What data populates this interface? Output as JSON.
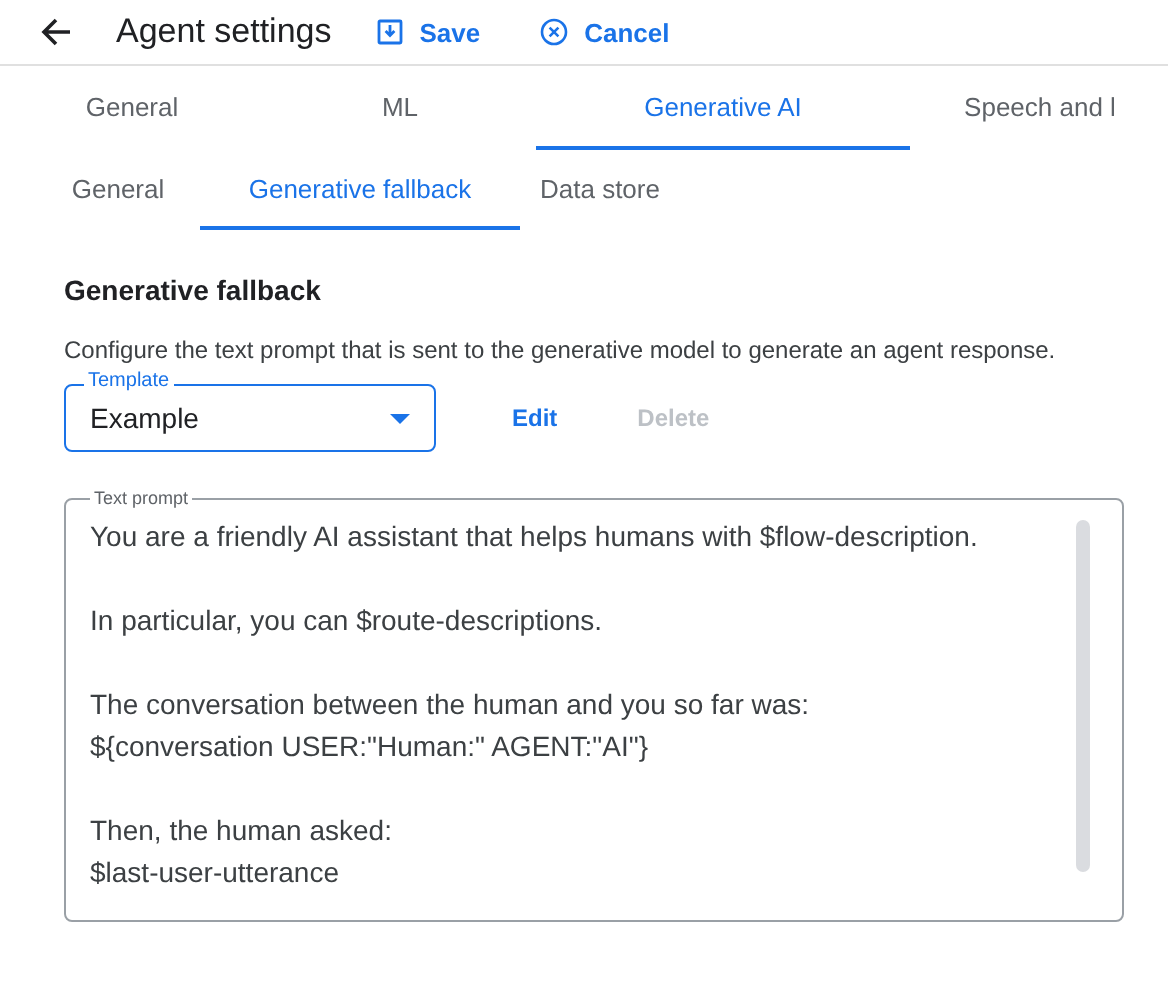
{
  "header": {
    "title": "Agent settings",
    "actions": [
      {
        "label": "Save",
        "kind": "save"
      },
      {
        "label": "Cancel",
        "kind": "cancel"
      }
    ]
  },
  "tabs": [
    {
      "label": "General",
      "selected": false
    },
    {
      "label": "ML",
      "selected": false
    },
    {
      "label": "Generative AI",
      "selected": true
    },
    {
      "label": "Speech and l",
      "selected": false
    }
  ],
  "subtabs": [
    {
      "label": "General",
      "selected": false
    },
    {
      "label": "Generative fallback",
      "selected": true
    },
    {
      "label": "Data store",
      "selected": false
    }
  ],
  "section": {
    "title": "Generative fallback",
    "description": "Configure the text prompt that is sent to the generative model to generate an agent response."
  },
  "template": {
    "label": "Template",
    "value": "Example"
  },
  "template_actions": [
    {
      "label": "Edit",
      "disabled": false
    },
    {
      "label": "Delete",
      "disabled": true
    }
  ],
  "text_prompt": {
    "label": "Text prompt",
    "paragraphs": [
      [
        "You are a friendly AI assistant that helps humans with $flow-description."
      ],
      [
        "In particular, you can $route-descriptions."
      ],
      [
        "The conversation between the human and you so far was:",
        "${conversation USER:\"Human:\" AGENT:\"AI\"}"
      ],
      [
        "Then, the human asked:",
        "$last-user-utterance"
      ]
    ]
  }
}
